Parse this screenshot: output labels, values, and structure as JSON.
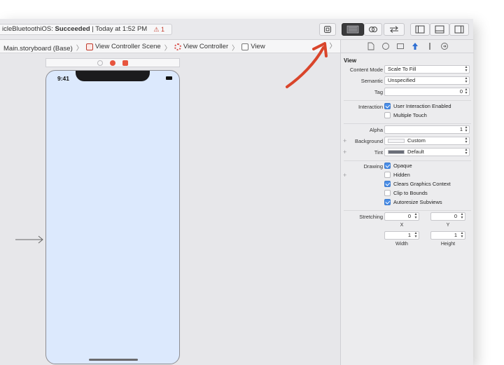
{
  "activity": {
    "project": "icleBluetoothiOS:",
    "status": "Succeeded",
    "time": "| Today at 1:52 PM",
    "warnings": "⚠ 1"
  },
  "jumpbar": {
    "items": [
      "Main.storyboard (Base)",
      "View Controller Scene",
      "View Controller",
      "View"
    ]
  },
  "device": {
    "time": "9:41"
  },
  "inspector": {
    "section": "View",
    "content_mode": {
      "label": "Content Mode",
      "value": "Scale To Fill"
    },
    "semantic": {
      "label": "Semantic",
      "value": "Unspecified"
    },
    "tag": {
      "label": "Tag",
      "value": "0"
    },
    "interaction": {
      "label": "Interaction",
      "options": [
        {
          "label": "User Interaction Enabled",
          "checked": true
        },
        {
          "label": "Multiple Touch",
          "checked": false
        }
      ]
    },
    "alpha": {
      "label": "Alpha",
      "value": "1"
    },
    "background": {
      "label": "Background",
      "value": "Custom"
    },
    "tint": {
      "label": "Tint",
      "value": "Default"
    },
    "drawing": {
      "label": "Drawing",
      "options": [
        {
          "label": "Opaque",
          "checked": true
        },
        {
          "label": "Hidden",
          "checked": false
        },
        {
          "label": "Clears Graphics Context",
          "checked": true
        },
        {
          "label": "Clip to Bounds",
          "checked": false
        },
        {
          "label": "Autoresize Subviews",
          "checked": true
        }
      ]
    },
    "stretching": {
      "label": "Stretching",
      "x": "0",
      "y": "0",
      "width": "1",
      "height": "1",
      "x_label": "X",
      "y_label": "Y",
      "width_label": "Width",
      "height_label": "Height"
    }
  },
  "colors": {
    "accent": "#4a8ee8",
    "annotation": "#d9452b",
    "canvas": "#e7e7ea",
    "view_bg": "#dce9fd"
  }
}
